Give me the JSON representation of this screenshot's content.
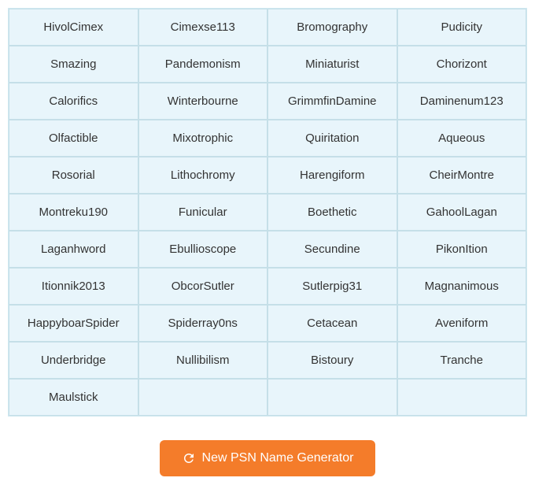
{
  "grid": {
    "cells": [
      "HivolCimex",
      "Cimexse113",
      "Bromography",
      "Pudicity",
      "Smazing",
      "Pandemonism",
      "Miniaturist",
      "Chorizont",
      "Calorifics",
      "Winterbourne",
      "GrimmfinDamine",
      "Daminenum123",
      "Olfactible",
      "Mixotrophic",
      "Quiritation",
      "Aqueous",
      "Rosorial",
      "Lithochromy",
      "Harengiform",
      "CheirMontre",
      "Montreku190",
      "Funicular",
      "Boethetic",
      "GahoolLagan",
      "Laganhword",
      "Ebullioscope",
      "Secundine",
      "PikonItion",
      "Itionnik2013",
      "ObcorSutler",
      "Sutlerpig31",
      "Magnanimous",
      "HappyboarSpider",
      "Spiderray0ns",
      "Cetacean",
      "Aveniform",
      "Underbridge",
      "Nullibilism",
      "Bistoury",
      "Tranche",
      "Maulstick",
      "",
      "",
      ""
    ],
    "columns": 4
  },
  "button": {
    "label": "New PSN Name Generator",
    "icon": "refresh-icon"
  }
}
